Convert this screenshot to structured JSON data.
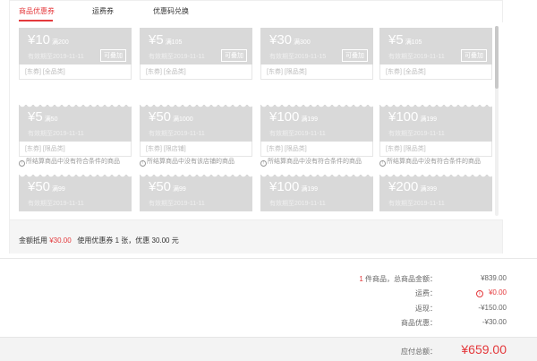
{
  "tabs": [
    "商品优惠券",
    "运费券",
    "优惠码兑换"
  ],
  "coupons": [
    {
      "amount": "¥10",
      "condition": "满200",
      "validity": "有效期至2019-11-11",
      "tags": "[东券] [全品类]",
      "stackable": "可叠加"
    },
    {
      "amount": "¥5",
      "condition": "满105",
      "validity": "有效期至2019-11-11",
      "tags": "[东券] [全品类]",
      "stackable": "可叠加"
    },
    {
      "amount": "¥30",
      "condition": "满300",
      "validity": "有效期至2019-11-15",
      "tags": "[东券] [限品类]",
      "stackable": "可叠加"
    },
    {
      "amount": "¥5",
      "condition": "满105",
      "validity": "有效期至2019-11-11",
      "tags": "[东券] [全品类]",
      "stackable": "可叠加"
    },
    {
      "amount": "¥5",
      "condition": "满50",
      "validity": "有效期至2019-11-11",
      "tags": "[东券] [限品类]",
      "note": "所结算商品中没有符合条件的商品"
    },
    {
      "amount": "¥50",
      "condition": "满1000",
      "validity": "有效期至2019-11-11",
      "tags": "[东券] [限店铺]",
      "note": "所结算商品中没有该店铺的商品"
    },
    {
      "amount": "¥100",
      "condition": "满199",
      "validity": "有效期至2019-11-11",
      "tags": "[东券] [限品类]",
      "note": "所结算商品中没有符合条件的商品"
    },
    {
      "amount": "¥100",
      "condition": "满199",
      "validity": "有效期至2019-11-11",
      "tags": "[东券] [限品类]",
      "note": "所结算商品中没有符合条件的商品"
    },
    {
      "amount": "¥50",
      "condition": "满99",
      "validity": "有效期至2019-11-11"
    },
    {
      "amount": "¥50",
      "condition": "满99",
      "validity": "有效期至2019-11-11"
    },
    {
      "amount": "¥100",
      "condition": "满199",
      "validity": "有效期至2019-11-11"
    },
    {
      "amount": "¥200",
      "condition": "满399",
      "validity": "有效期至2019-11-11"
    }
  ],
  "summary": {
    "prefix": "金额抵用",
    "amount": "¥30.00",
    "detail": "使用优惠券 1 张，优惠 30.00 元"
  },
  "totals": {
    "count": "1",
    "count_label": "件商品，总商品金额：",
    "goods_amount": "¥839.00",
    "shipping_label": "运费：",
    "shipping": "¥0.00",
    "cashback_label": "返现：",
    "cashback": "-¥150.00",
    "discount_label": "商品优惠：",
    "discount": "-¥30.00",
    "payable_label": "应付总额：",
    "payable": "¥659.00"
  },
  "colors": {
    "accent": "#e4393c",
    "coupon_gray": "#d9d9d9"
  }
}
